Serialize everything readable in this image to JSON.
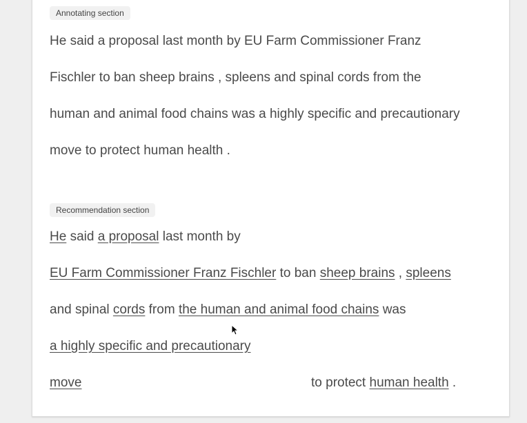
{
  "annotating": {
    "tag": "Annotating section",
    "text": "He said a proposal last month by EU Farm Commissioner Franz Fischler to ban sheep brains , spleens and spinal cords from the human and animal food chains was a highly specific and precautionary move to protect human health ."
  },
  "recommendation": {
    "tag": "Recommendation section",
    "lines": [
      [
        {
          "t": "He",
          "u": true
        },
        {
          "t": " said ",
          "u": false
        },
        {
          "t": "a proposal",
          "u": true
        },
        {
          "t": " last month by",
          "u": false
        }
      ],
      [
        {
          "t": "EU Farm Commissioner Franz Fischler",
          "u": true
        },
        {
          "t": " to ban ",
          "u": false
        },
        {
          "t": "sheep brains",
          "u": true
        },
        {
          "t": " , ",
          "u": false
        },
        {
          "t": "spleens",
          "u": true
        }
      ],
      [
        {
          "t": "and spinal ",
          "u": false
        },
        {
          "t": "cords",
          "u": true
        },
        {
          "t": " from ",
          "u": false
        },
        {
          "t": "the human and animal food chains",
          "u": true
        },
        {
          "t": " was",
          "u": false
        }
      ],
      [
        {
          "t": "a highly specific and precautionary",
          "u": true
        }
      ],
      [
        {
          "t": "move",
          "u": true
        }
      ],
      [
        {
          "t": "to protect ",
          "u": false
        },
        {
          "t": "human health",
          "u": true
        },
        {
          "t": " .",
          "u": false
        }
      ]
    ]
  },
  "cursor_icon": "mouse-pointer-icon"
}
